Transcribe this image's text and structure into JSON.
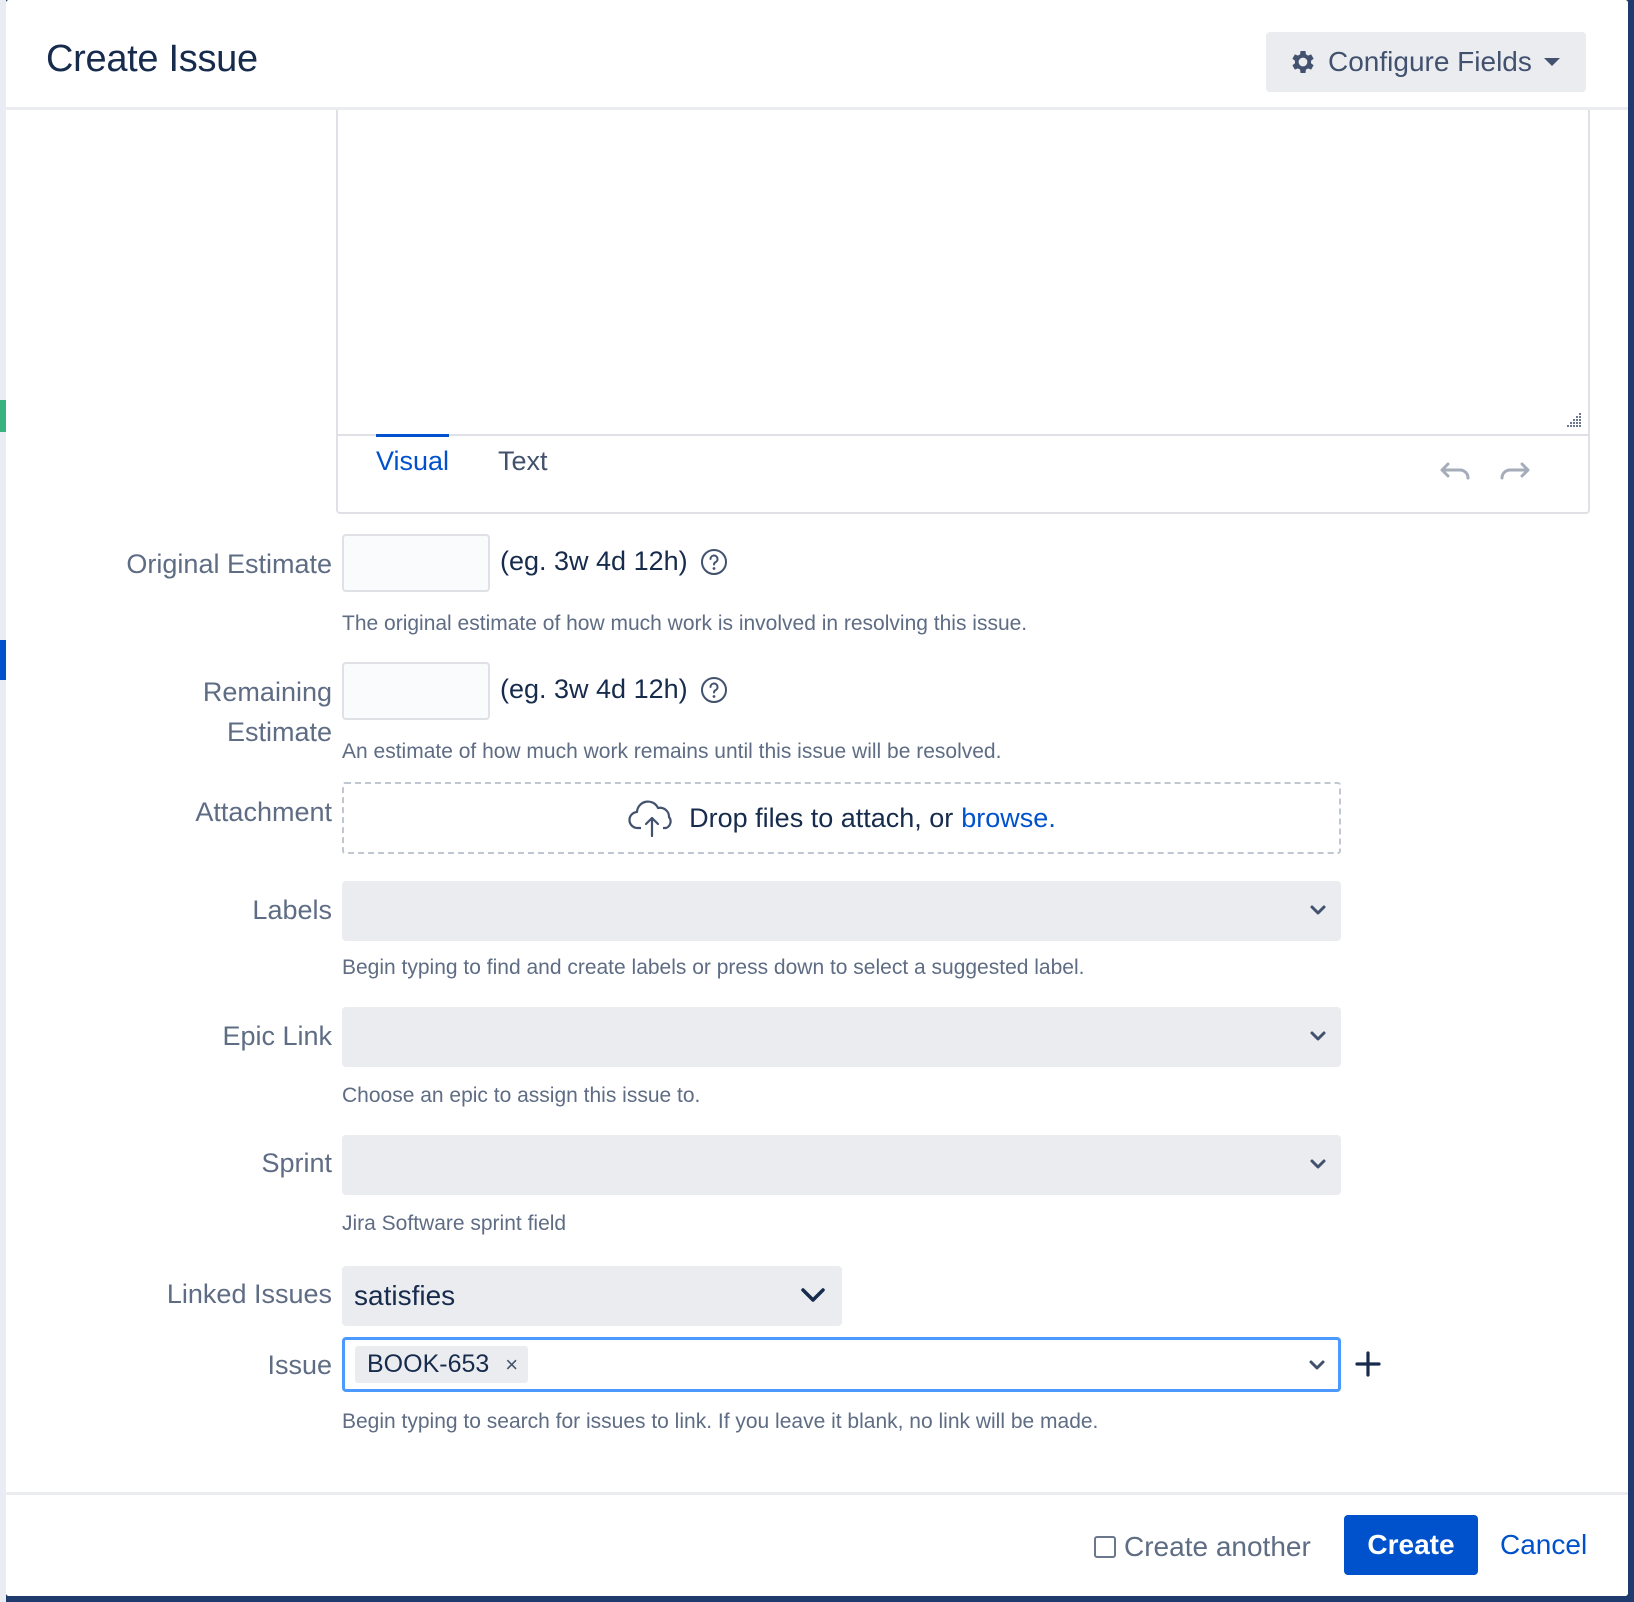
{
  "dialog": {
    "title": "Create Issue",
    "configure_fields_label": "Configure Fields"
  },
  "editor": {
    "tabs": [
      {
        "label": "Visual",
        "active": true
      },
      {
        "label": "Text",
        "active": false
      }
    ]
  },
  "fields": {
    "original_estimate": {
      "label": "Original Estimate",
      "value": "",
      "hint": "(eg. 3w 4d 12h)",
      "description": "The original estimate of how much work is involved in resolving this issue."
    },
    "remaining_estimate": {
      "label_line1": "Remaining",
      "label_line2": "Estimate",
      "value": "",
      "hint": "(eg. 3w 4d 12h)",
      "description": "An estimate of how much work remains until this issue will be resolved."
    },
    "attachment": {
      "label": "Attachment",
      "drop_text": "Drop files to attach, or",
      "browse_text": "browse."
    },
    "labels": {
      "label": "Labels",
      "value": "",
      "description": "Begin typing to find and create labels or press down to select a suggested label."
    },
    "epic_link": {
      "label": "Epic Link",
      "value": "",
      "description": "Choose an epic to assign this issue to."
    },
    "sprint": {
      "label": "Sprint",
      "value": "",
      "description": "Jira Software sprint field"
    },
    "linked_issues": {
      "label": "Linked Issues",
      "value": "satisfies"
    },
    "issue": {
      "label": "Issue",
      "tokens": [
        "BOOK-653"
      ],
      "remove_symbol": "×",
      "description": "Begin typing to search for issues to link. If you leave it blank, no link will be made."
    }
  },
  "footer": {
    "create_another_label": "Create another",
    "create_another_checked": false,
    "create_label": "Create",
    "cancel_label": "Cancel"
  },
  "colors": {
    "primary": "#0052cc",
    "focus_border": "#4c9aff",
    "field_bg": "#ebecf0",
    "label_text": "#5e6c84",
    "body_text": "#172b4d"
  },
  "icons": {
    "configure": "gear-icon",
    "help": "help-circle-icon",
    "upload": "cloud-upload-icon",
    "dropdown": "chevron-down-icon",
    "add": "plus-icon",
    "undo": "undo-icon",
    "redo": "redo-icon"
  }
}
